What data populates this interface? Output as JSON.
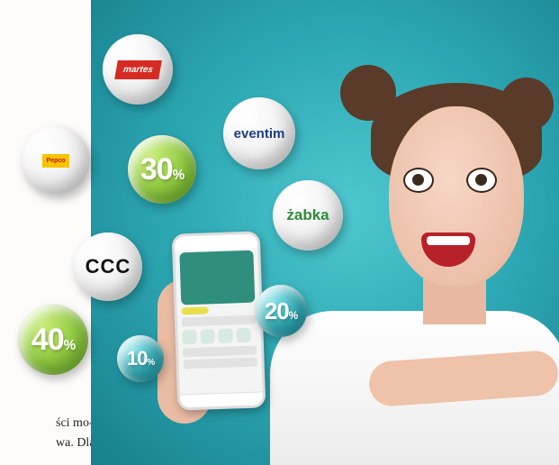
{
  "article": {
    "line1": "ści mo-",
    "line2": "wa. Dla"
  },
  "logos": {
    "martes": "martes",
    "eventim": "eventim",
    "zabka": "żabka",
    "ccc": "CCC",
    "yellow_store": "Pepco"
  },
  "discounts": {
    "d30": "30",
    "d20": "20",
    "d40": "40",
    "d10": "10",
    "pct_sign": "%"
  },
  "colors": {
    "background_teal": "#2eaab5",
    "green_ball": "#8cc83d",
    "teal_ball": "#2fa8b3",
    "martes_red": "#d72a23",
    "yellow_logo": "#f6c400"
  },
  "icons": [
    "phone-app-mockup"
  ]
}
